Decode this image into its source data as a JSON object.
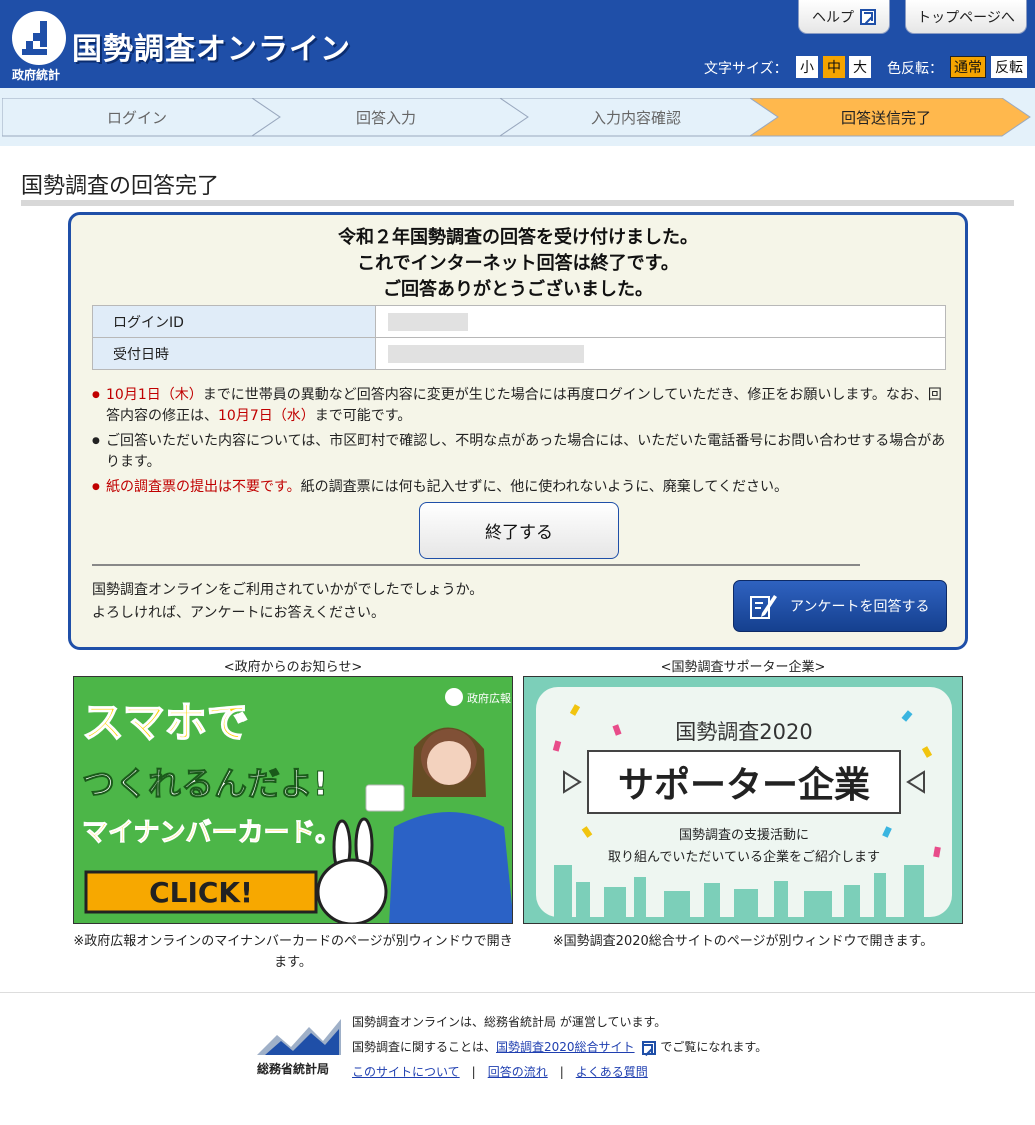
{
  "header": {
    "logo_sub": "政府統計",
    "logo_title": "国勢調査オンライン",
    "help_label": "ヘルプ",
    "top_label": "トップページへ",
    "font_size_label": "文字サイズ：",
    "font_small": "小",
    "font_mid": "中",
    "font_large": "大",
    "invert_label": "色反転：",
    "invert_normal": "通常",
    "invert_reverse": "反転",
    "brand_color": "#1f4fa8",
    "accent_color": "#f5a400"
  },
  "steps": [
    {
      "label": "ログイン",
      "active": false
    },
    {
      "label": "回答入力",
      "active": false
    },
    {
      "label": "入力内容確認",
      "active": false
    },
    {
      "label": "回答送信完了",
      "active": true
    }
  ],
  "page": {
    "title": "国勢調査の回答完了"
  },
  "completion": {
    "msg1": "令和２年国勢調査の回答を受け付けました。",
    "msg2": "これでインターネット回答は終了です。",
    "msg3": "ご回答ありがとうございました。",
    "login_id_label": "ログインID",
    "received_label": "受付日時",
    "notes": {
      "n1_red1": "10月1日（木）",
      "n1_text1": "までに世帯員の異動など回答内容に変更が生じた場合には再度ログインしていただき、修正をお願いします。なお、回答内容の修正は、",
      "n1_red2": "10月7日（水）",
      "n1_text2": "まで可能です。",
      "n2_text": "ご回答いただいた内容については、市区町村で確認し、不明な点があった場合には、いただいた電話番号にお問い合わせする場合があります。",
      "n3_red": "紙の調査票の提出は不要です。",
      "n3_text": "紙の調査票には何も記入せずに、他に使われないように、廃棄してください。"
    },
    "end_button": "終了する",
    "survey_line1": "国勢調査オンラインをご利用されていかがでしたでしょうか。",
    "survey_line2": "よろしければ、アンケートにお答えください。",
    "survey_button": "アンケートを回答する"
  },
  "banners": {
    "left_caption": "<政府からのお知らせ>",
    "right_caption": "<国勢調査サポーター企業>",
    "left": {
      "badge": "政府広報",
      "line1": "スマホで",
      "line2": "つくれるんだよ!",
      "line3": "マイナンバーカード。",
      "cta": "CLICK!"
    },
    "right": {
      "heading": "国勢調査2020",
      "main": "サポーター企業",
      "sub1": "国勢調査の支援活動に",
      "sub2": "取り組んでいただいている企業をご紹介します"
    },
    "left_note": "※政府広報オンラインのマイナンバーカードのページが別ウィンドウで開きます。",
    "right_note": "※国勢調査2020総合サイトのページが別ウィンドウで開きます。"
  },
  "footer": {
    "logo_text": "総務省統計局",
    "line1": "国勢調査オンラインは、総務省統計局 が運営しています。",
    "line2_pre": "国勢調査に関することは、",
    "line2_link": "国勢調査2020総合サイト",
    "line2_post": "でご覧になれます。",
    "link_about": "このサイトについて",
    "link_flow": "回答の流れ",
    "link_faq": "よくある質問",
    "sep": "|"
  }
}
